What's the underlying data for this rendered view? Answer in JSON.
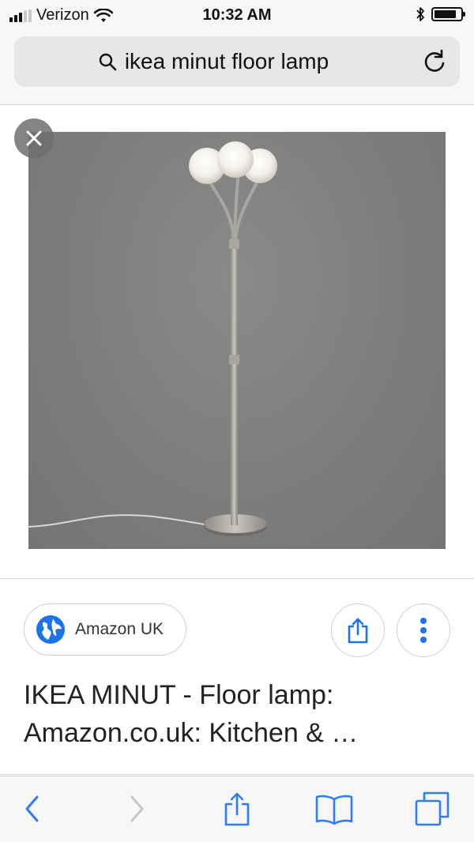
{
  "status_bar": {
    "carrier": "Verizon",
    "time": "10:32 AM",
    "signal_bars_filled": 3,
    "signal_bars_total": 5,
    "battery_level": 0.85,
    "icons": [
      "signal-icon",
      "wifi-icon",
      "bluetooth-icon",
      "battery-icon"
    ]
  },
  "address_bar": {
    "query": "ikea minut floor lamp",
    "icons": [
      "search-icon",
      "reload-icon"
    ]
  },
  "viewer": {
    "image_alt": "floor lamp",
    "close_icon": "close-icon"
  },
  "result": {
    "source": "Amazon UK",
    "title": "IKEA MINUT - Floor lamp: Amazon.co.uk: Kitchen & …",
    "icons": [
      "globe-icon",
      "share-icon",
      "more-vert-icon"
    ]
  },
  "toolbar": {
    "icons": [
      "back-icon",
      "forward-icon",
      "share-icon",
      "bookmarks-icon",
      "tabs-icon"
    ]
  },
  "colors": {
    "accent": "#1a73e8",
    "ios_blue": "#2f7cf6",
    "photo_bg": "#7c7c7c"
  }
}
